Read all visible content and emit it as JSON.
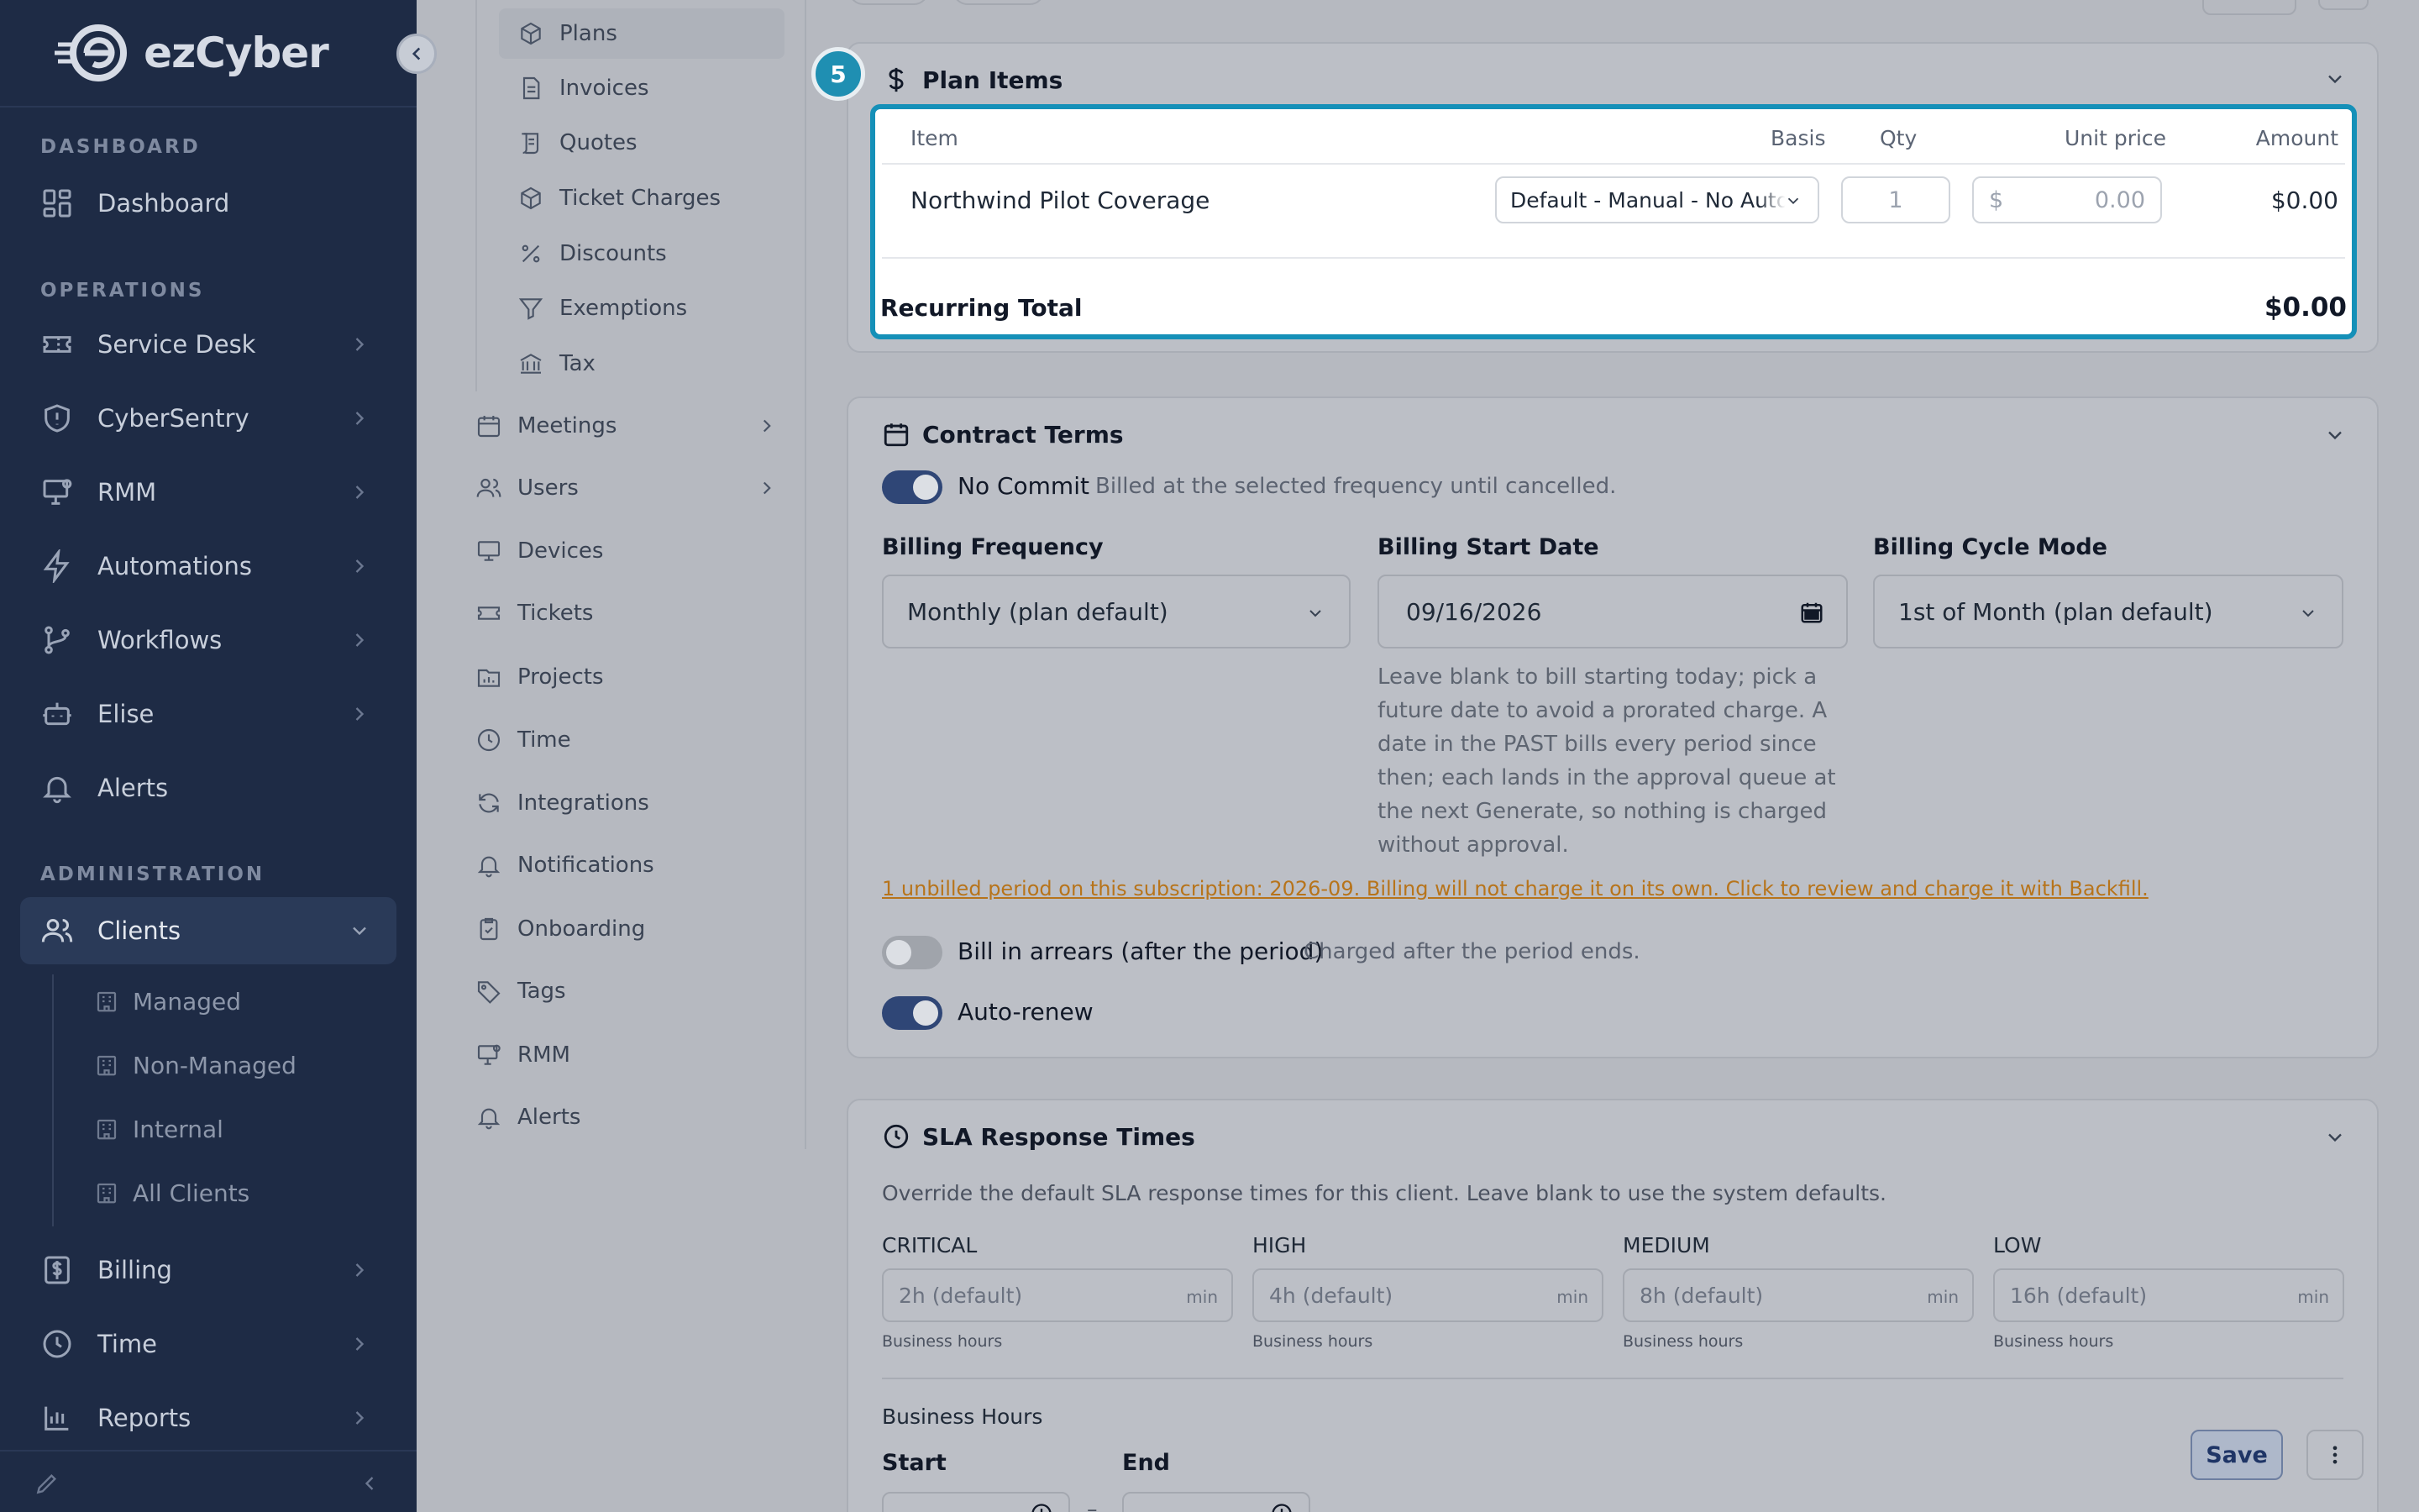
{
  "brand": {
    "name": "ezCyber"
  },
  "sidebar": {
    "sections": [
      "DASHBOARD",
      "OPERATIONS",
      "ADMINISTRATION"
    ],
    "items": [
      {
        "label": "Dashboard",
        "icon": "grid-icon"
      },
      {
        "label": "Service Desk",
        "icon": "ticket-icon"
      },
      {
        "label": "CyberSentry",
        "icon": "shield-icon"
      },
      {
        "label": "RMM",
        "icon": "monitor-icon"
      },
      {
        "label": "Automations",
        "icon": "bolt-icon"
      },
      {
        "label": "Workflows",
        "icon": "branch-icon"
      },
      {
        "label": "Elise",
        "icon": "robot-icon"
      },
      {
        "label": "Alerts",
        "icon": "bell-icon"
      },
      {
        "label": "Clients",
        "icon": "users-icon"
      },
      {
        "label": "Billing",
        "icon": "dollar-doc-icon"
      },
      {
        "label": "Time",
        "icon": "clock-icon"
      },
      {
        "label": "Reports",
        "icon": "bar-chart-icon"
      }
    ],
    "client_subitems": [
      "Managed",
      "Non-Managed",
      "Internal",
      "All Clients"
    ]
  },
  "subnav": {
    "items": [
      "Plans",
      "Invoices",
      "Quotes",
      "Ticket Charges",
      "Discounts",
      "Exemptions",
      "Tax",
      "Meetings",
      "Users",
      "Devices",
      "Tickets",
      "Projects",
      "Time",
      "Integrations",
      "Notifications",
      "Onboarding",
      "Tags",
      "RMM",
      "Alerts"
    ]
  },
  "plan_items": {
    "step": "5",
    "title": "Plan Items",
    "headers": {
      "item": "Item",
      "basis": "Basis",
      "qty": "Qty",
      "unit_price": "Unit price",
      "amount": "Amount"
    },
    "row": {
      "item": "Northwind Pilot Coverage",
      "basis": "Default - Manual - No Auto-Sync",
      "qty": "1",
      "currency": "$",
      "unit_price": "0.00",
      "amount": "$0.00"
    },
    "total_label": "Recurring Total",
    "total_value": "$0.00"
  },
  "contract_terms": {
    "title": "Contract Terms",
    "no_commit_label": "No Commit",
    "no_commit_desc": "Billed at the selected frequency until cancelled.",
    "billing_frequency_label": "Billing Frequency",
    "billing_frequency_value": "Monthly (plan default)",
    "billing_start_label": "Billing Start Date",
    "billing_start_value": "09/16/2026",
    "billing_cycle_label": "Billing Cycle Mode",
    "billing_cycle_value": "1st of Month (plan default)",
    "help_lines": [
      "Leave blank to bill starting today; pick a",
      "future date to avoid a prorated charge. A",
      "date in the PAST bills every period since",
      "then; each lands in the approval queue at",
      "the next Generate, so nothing is charged",
      "without approval."
    ],
    "warning_link": "1 unbilled period on this subscription: 2026-09. Billing will not charge it on its own. Click to review and charge it with Backfill.",
    "arrears_label": "Bill in arrears (after the period)",
    "arrears_desc": "Charged after the period ends.",
    "auto_renew_label": "Auto-renew"
  },
  "sla": {
    "title": "SLA Response Times",
    "description": "Override the default SLA response times for this client. Leave blank to use the system defaults.",
    "fields": [
      {
        "label": "CRITICAL",
        "placeholder": "2h (default)",
        "unit": "min",
        "hint": "Business hours"
      },
      {
        "label": "HIGH",
        "placeholder": "4h (default)",
        "unit": "min",
        "hint": "Business hours"
      },
      {
        "label": "MEDIUM",
        "placeholder": "8h (default)",
        "unit": "min",
        "hint": "Business hours"
      },
      {
        "label": "LOW",
        "placeholder": "16h (default)",
        "unit": "min",
        "hint": "Business hours"
      }
    ],
    "business_hours_label": "Business Hours",
    "start_label": "Start",
    "end_label": "End",
    "separator": "–"
  },
  "actions": {
    "save_label": "Save"
  }
}
